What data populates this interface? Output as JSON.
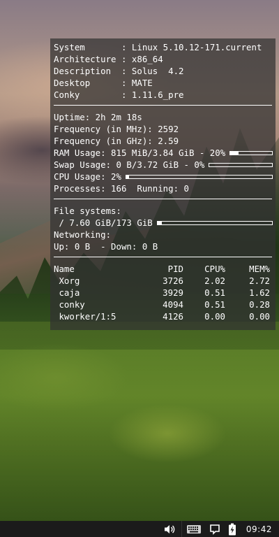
{
  "system": {
    "rows": [
      {
        "label": "System      ",
        "value": ": Linux 5.10.12-171.current"
      },
      {
        "label": "Architecture",
        "value": ": x86_64"
      },
      {
        "label": "Description ",
        "value": ": Solus  4.2"
      },
      {
        "label": "Desktop     ",
        "value": ": MATE"
      },
      {
        "label": "Conky       ",
        "value": ": 1.11.6_pre"
      }
    ]
  },
  "stats": {
    "uptime": "Uptime: 2h 2m 18s",
    "freq_mhz": "Frequency (in MHz): 2592",
    "freq_ghz": "Frequency (in GHz): 2.59",
    "ram": {
      "text": "RAM Usage: 815 MiB/3.84 GiB - 20%",
      "percent": 20
    },
    "swap": {
      "text": "Swap Usage: 0 B/3.72 GiB - 0%",
      "percent": 0
    },
    "cpu": {
      "text": "CPU Usage: 2%",
      "percent": 2
    },
    "processes": "Processes: 166  Running: 0"
  },
  "filesystems": {
    "heading": "File systems:",
    "root": {
      "text": " / 7.60 GiB/173 GiB",
      "percent": 4
    },
    "net_heading": "Networking:",
    "net": "Up: 0 B  - Down: 0 B"
  },
  "processes": {
    "headers": {
      "name": "Name",
      "pid": "PID",
      "cpu": "CPU%",
      "mem": "MEM%"
    },
    "rows": [
      {
        "name": " Xorg",
        "pid": "3726",
        "cpu": "2.02",
        "mem": "2.72"
      },
      {
        "name": " caja",
        "pid": "3929",
        "cpu": "0.51",
        "mem": "1.62"
      },
      {
        "name": " conky",
        "pid": "4094",
        "cpu": "0.51",
        "mem": "0.28"
      },
      {
        "name": " kworker/1:5",
        "pid": "4126",
        "cpu": "0.00",
        "mem": "0.00"
      }
    ]
  },
  "taskbar": {
    "clock": "09:42",
    "icons": [
      "volume-icon",
      "keyboard-icon",
      "notification-icon",
      "battery-charging-icon"
    ]
  }
}
